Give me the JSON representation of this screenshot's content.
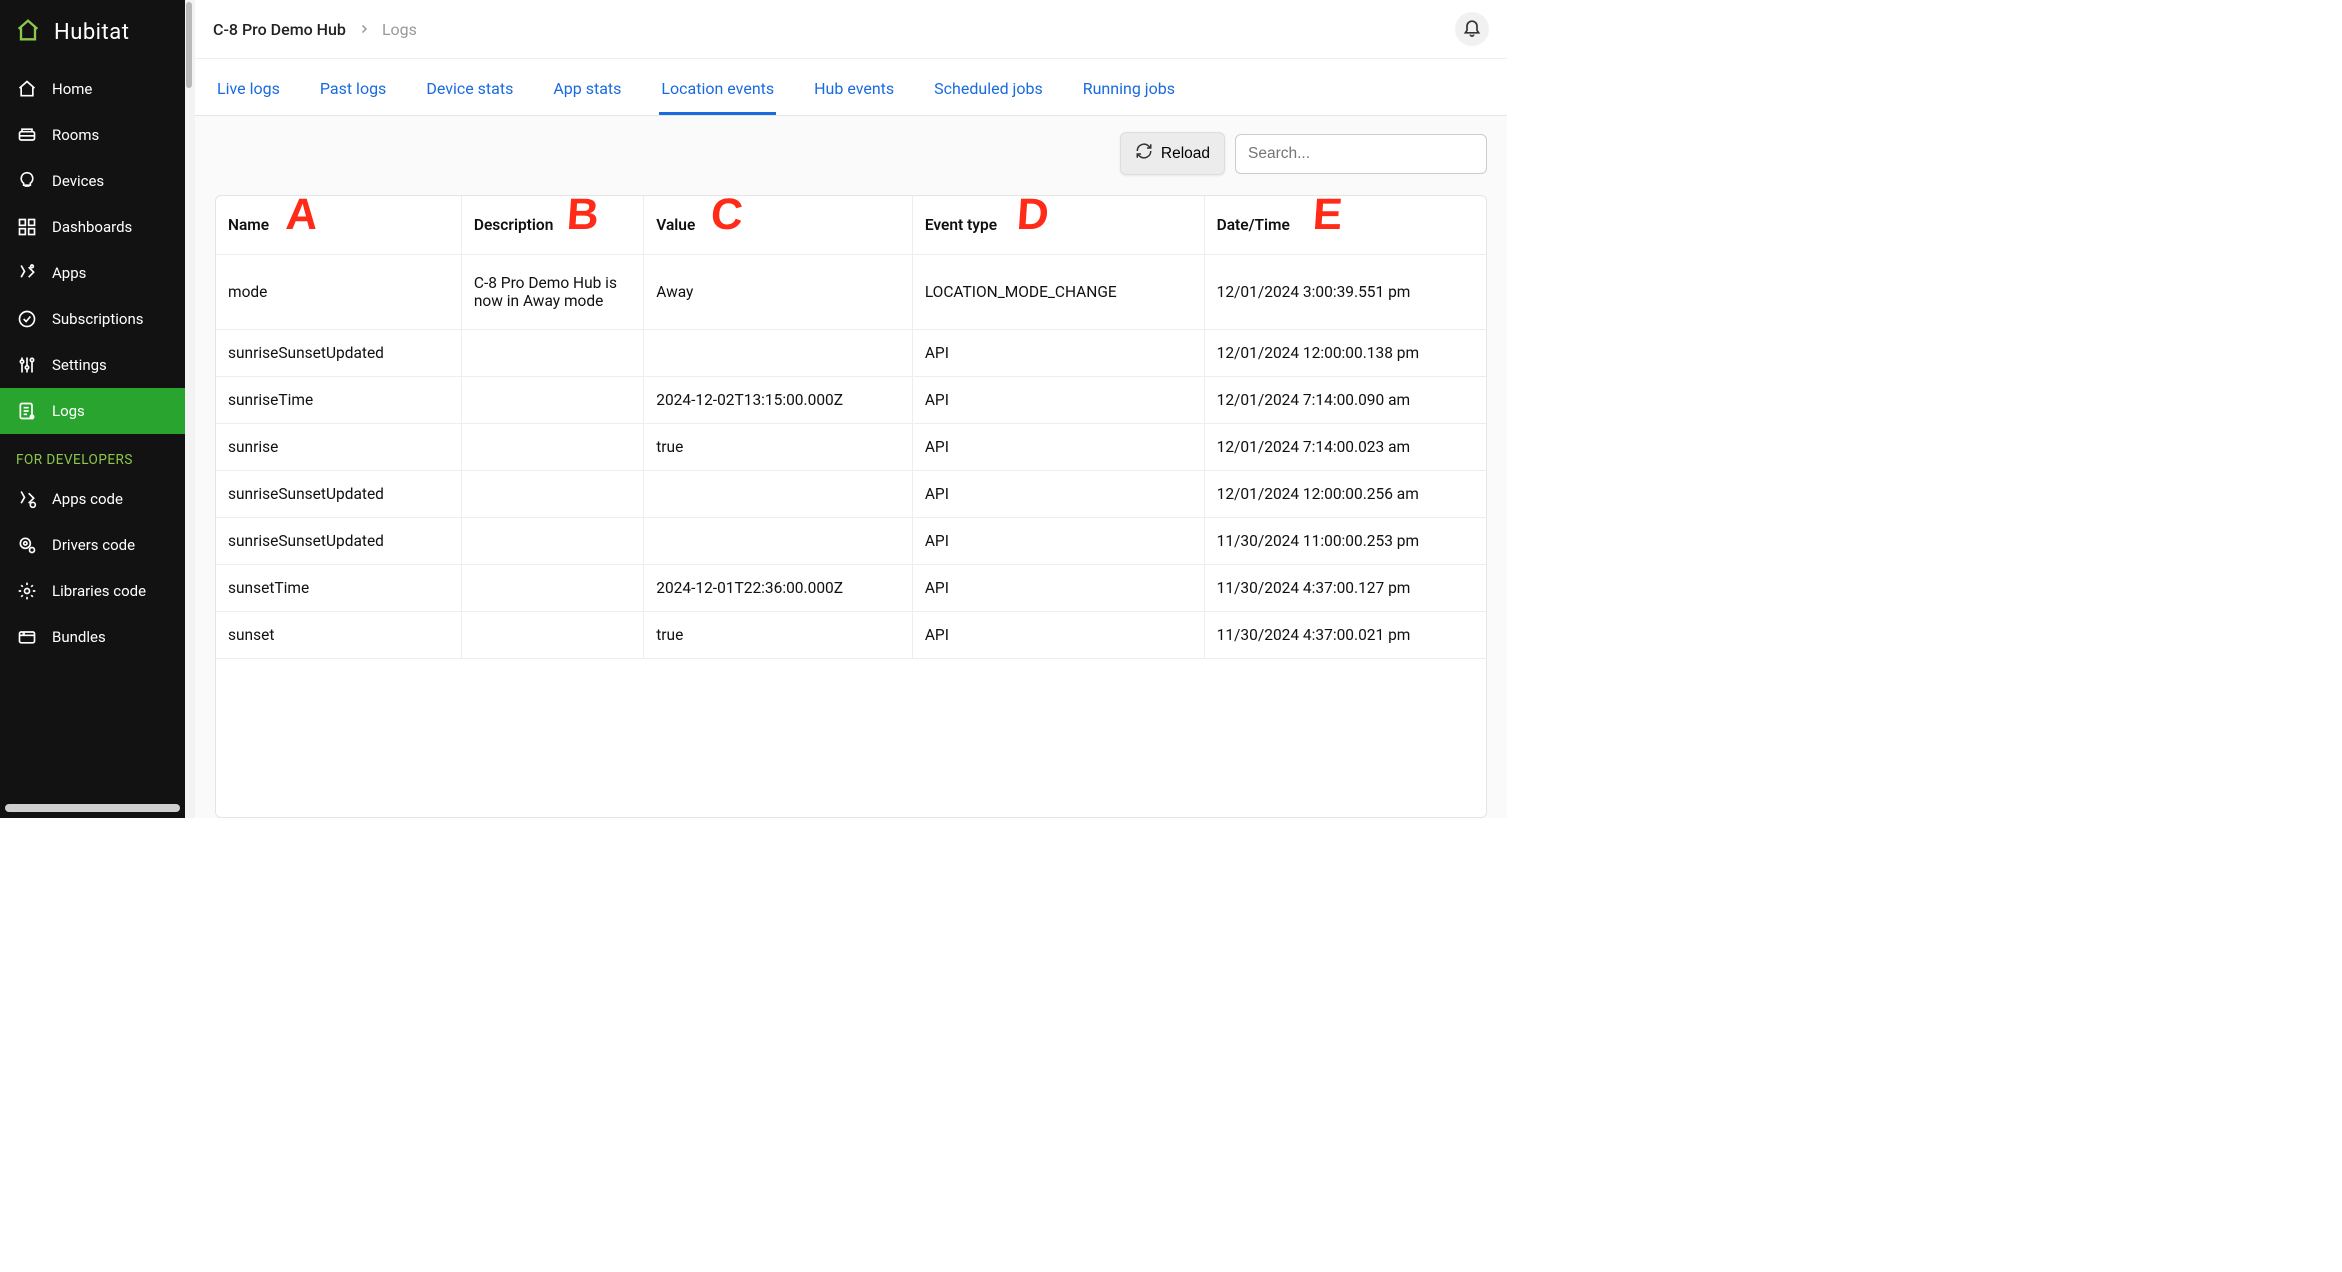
{
  "brand": "Hubitat",
  "sidebar": {
    "items": [
      {
        "label": "Home"
      },
      {
        "label": "Rooms"
      },
      {
        "label": "Devices"
      },
      {
        "label": "Dashboards"
      },
      {
        "label": "Apps"
      },
      {
        "label": "Subscriptions"
      },
      {
        "label": "Settings"
      },
      {
        "label": "Logs"
      }
    ],
    "dev_header": "FOR DEVELOPERS",
    "dev_items": [
      {
        "label": "Apps code"
      },
      {
        "label": "Drivers code"
      },
      {
        "label": "Libraries code"
      },
      {
        "label": "Bundles"
      }
    ]
  },
  "breadcrumb": {
    "hub": "C-8 Pro Demo Hub",
    "leaf": "Logs"
  },
  "tabs": [
    {
      "label": "Live logs"
    },
    {
      "label": "Past logs"
    },
    {
      "label": "Device stats"
    },
    {
      "label": "App stats"
    },
    {
      "label": "Location events"
    },
    {
      "label": "Hub events"
    },
    {
      "label": "Scheduled jobs"
    },
    {
      "label": "Running jobs"
    }
  ],
  "toolbar": {
    "reload_label": "Reload",
    "search_placeholder": "Search..."
  },
  "columns": {
    "name": "Name",
    "description": "Description",
    "value": "Value",
    "event_type": "Event type",
    "date_time": "Date/Time"
  },
  "annotations": {
    "A": "A",
    "B": "B",
    "C": "C",
    "D": "D",
    "E": "E"
  },
  "rows": [
    {
      "name": "mode",
      "description": "C-8 Pro Demo Hub is now in Away mode",
      "value": "Away",
      "event_type": "LOCATION_MODE_CHANGE",
      "date_time": "12/01/2024 3:00:39.551 pm"
    },
    {
      "name": "sunriseSunsetUpdated",
      "description": "",
      "value": "",
      "event_type": "API",
      "date_time": "12/01/2024 12:00:00.138 pm"
    },
    {
      "name": "sunriseTime",
      "description": "",
      "value": "2024-12-02T13:15:00.000Z",
      "event_type": "API",
      "date_time": "12/01/2024 7:14:00.090 am"
    },
    {
      "name": "sunrise",
      "description": "",
      "value": "true",
      "event_type": "API",
      "date_time": "12/01/2024 7:14:00.023 am"
    },
    {
      "name": "sunriseSunsetUpdated",
      "description": "",
      "value": "",
      "event_type": "API",
      "date_time": "12/01/2024 12:00:00.256 am"
    },
    {
      "name": "sunriseSunsetUpdated",
      "description": "",
      "value": "",
      "event_type": "API",
      "date_time": "11/30/2024 11:00:00.253 pm"
    },
    {
      "name": "sunsetTime",
      "description": "",
      "value": "2024-12-01T22:36:00.000Z",
      "event_type": "API",
      "date_time": "11/30/2024 4:37:00.127 pm"
    },
    {
      "name": "sunset",
      "description": "",
      "value": "true",
      "event_type": "API",
      "date_time": "11/30/2024 4:37:00.021 pm"
    }
  ]
}
